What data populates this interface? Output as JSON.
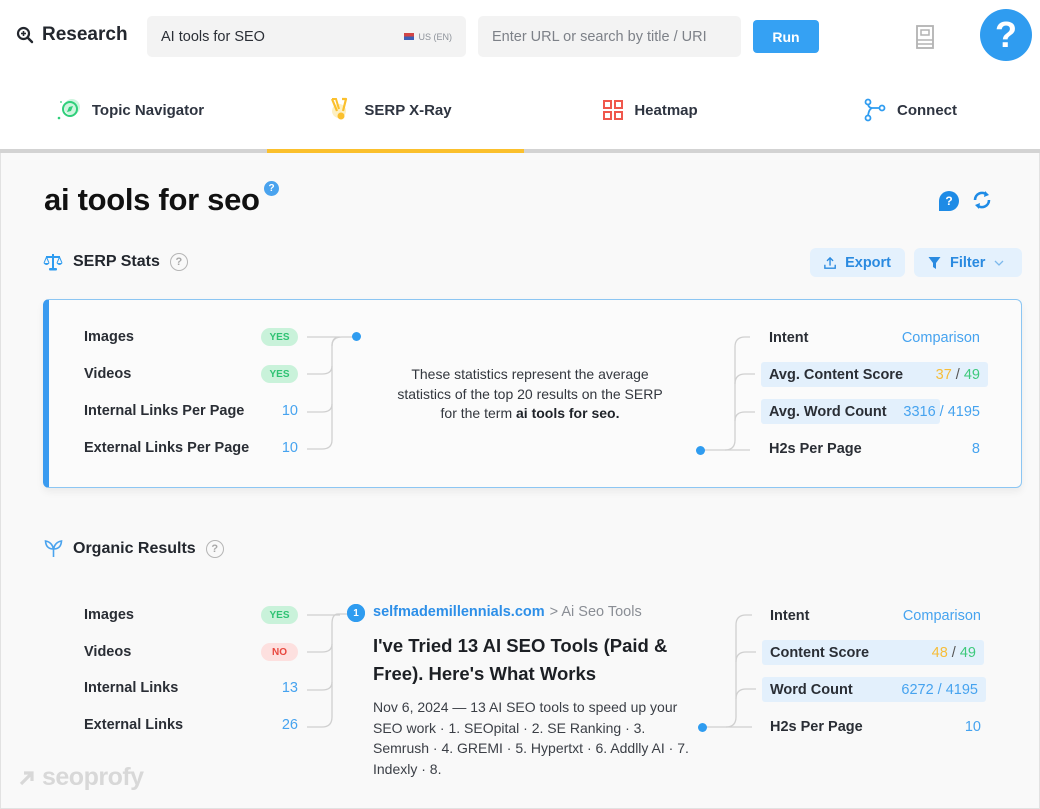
{
  "header": {
    "brand_label": "Research",
    "keyword_value": "AI tools for SEO",
    "locale": "US (EN)",
    "url_placeholder": "Enter URL or search by title / URI",
    "run_label": "Run",
    "help_label": "?"
  },
  "tabs": [
    {
      "label": "Topic Navigator",
      "icon": "compass-icon",
      "active": false
    },
    {
      "label": "SERP X-Ray",
      "icon": "xray-icon",
      "active": true
    },
    {
      "label": "Heatmap",
      "icon": "grid-icon",
      "active": false
    },
    {
      "label": "Connect",
      "icon": "nodes-icon",
      "active": false
    }
  ],
  "page": {
    "title": "ai tools for seo",
    "title_help": "?",
    "help_bubble": "?"
  },
  "serp_stats": {
    "title": "SERP Stats",
    "help": "?",
    "export_label": "Export",
    "filter_label": "Filter",
    "left": [
      {
        "label": "Images",
        "value": "YES",
        "type": "pill-yes"
      },
      {
        "label": "Videos",
        "value": "YES",
        "type": "pill-yes"
      },
      {
        "label": "Internal Links Per Page",
        "value": "10",
        "type": "number"
      },
      {
        "label": "External Links Per Page",
        "value": "10",
        "type": "number"
      }
    ],
    "note_prefix": "These statistics represent the average statistics of the top 20 results on the SERP for the term ",
    "note_term": "ai tools for seo.",
    "right": {
      "intent_label": "Intent",
      "intent_value": "Comparison",
      "content_score_label": "Avg. Content Score",
      "content_score_value": "37",
      "content_score_target": "49",
      "word_count_label": "Avg. Word Count",
      "word_count_value": "3316",
      "word_count_target": "4195",
      "h2_label": "H2s Per Page",
      "h2_value": "8"
    }
  },
  "organic": {
    "title": "Organic Results",
    "help": "?",
    "results": [
      {
        "rank": "1",
        "left": [
          {
            "label": "Images",
            "value": "YES",
            "type": "pill-yes"
          },
          {
            "label": "Videos",
            "value": "NO",
            "type": "pill-no"
          },
          {
            "label": "Internal Links",
            "value": "13",
            "type": "number"
          },
          {
            "label": "External Links",
            "value": "26",
            "type": "number"
          }
        ],
        "domain": "selfmademillennials.com",
        "breadcrumb": "> Ai Seo Tools",
        "title": "I've Tried 13 AI SEO Tools (Paid & Free). Here's What Works",
        "snippet": "Nov 6, 2024 — 13 AI SEO tools to speed up your SEO work · 1. SEOpital · 2. SE Ranking · 3. Semrush · 4. GREMI · 5. Hypertxt · 6. Addlly AI · 7. Indexly · 8.",
        "right": {
          "intent_label": "Intent",
          "intent_value": "Comparison",
          "content_score_label": "Content Score",
          "content_score_value": "48",
          "content_score_target": "49",
          "word_count_label": "Word Count",
          "word_count_value": "6272",
          "word_count_target": "4195",
          "h2_label": "H2s Per Page",
          "h2_value": "10"
        }
      }
    ]
  },
  "watermark": "seoprofy",
  "colors": {
    "accent_blue": "#2f9cf0",
    "active_tab": "#fbc02d",
    "yes_green": "#2ec273",
    "no_red": "#e8483f",
    "score_yellow": "#f6bd3a"
  }
}
